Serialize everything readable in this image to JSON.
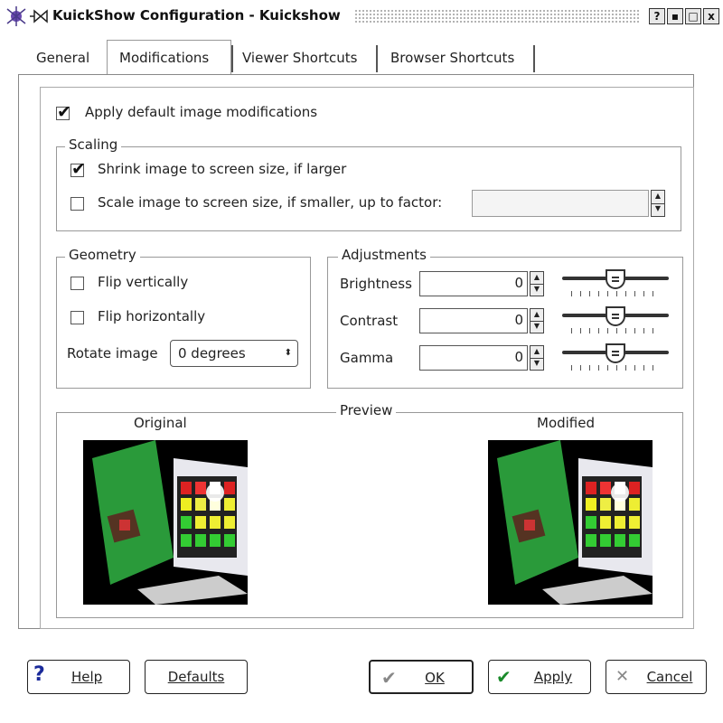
{
  "window": {
    "title": "KuickShow Configuration - Kuickshow",
    "controls": [
      "?",
      "▪",
      "□",
      "x"
    ]
  },
  "tabs": [
    {
      "label": "General",
      "active": false
    },
    {
      "label": "Modifications",
      "active": true
    },
    {
      "label": "Viewer Shortcuts",
      "active": false
    },
    {
      "label": "Browser Shortcuts",
      "active": false
    }
  ],
  "main": {
    "apply_default_label": "Apply default image modifications",
    "apply_default_checked": true
  },
  "scaling": {
    "legend": "Scaling",
    "shrink_label": "Shrink image to screen size, if larger",
    "shrink_checked": true,
    "scale_label": "Scale image to screen size, if smaller, up to factor:",
    "scale_checked": false,
    "factor_value": ""
  },
  "geometry": {
    "legend": "Geometry",
    "flip_v_label": "Flip vertically",
    "flip_h_label": "Flip horizontally",
    "rotate_label": "Rotate image",
    "rotate_value": "0 degrees"
  },
  "adjustments": {
    "legend": "Adjustments",
    "rows": [
      {
        "label": "Brightness",
        "value": "0",
        "slider_fraction": 0.5
      },
      {
        "label": "Contrast",
        "value": "0",
        "slider_fraction": 0.5
      },
      {
        "label": "Gamma",
        "value": "0",
        "slider_fraction": 0.5
      }
    ]
  },
  "preview": {
    "legend": "Preview",
    "original_label": "Original",
    "modified_label": "Modified"
  },
  "buttons": {
    "help": "Help",
    "defaults": "Defaults",
    "ok": "OK",
    "apply": "Apply",
    "cancel": "Cancel"
  },
  "colors": {
    "apply_check": "#1a8a2a",
    "cancel_x": "#888888",
    "ok_check": "#888888",
    "help_icon": "#1a2a9a"
  }
}
